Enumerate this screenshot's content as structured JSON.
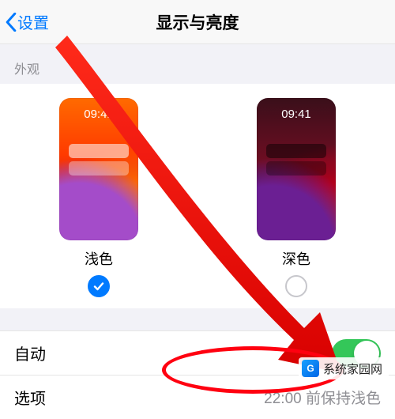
{
  "header": {
    "back": "设置",
    "title": "显示与亮度"
  },
  "section": {
    "appearance_label": "外观"
  },
  "themes": {
    "light": {
      "name": "浅色",
      "clock": "09:41"
    },
    "dark": {
      "name": "深色",
      "clock": "09:41"
    }
  },
  "rows": {
    "auto": {
      "label": "自动",
      "on": true
    },
    "options": {
      "label": "选项",
      "value": "22:00 前保持浅色"
    }
  },
  "watermark": {
    "text": "系统家园网",
    "logo_letter": "G"
  },
  "colors": {
    "accent": "#007aff",
    "switch_on": "#34c759",
    "annotation": "#ff0010"
  }
}
